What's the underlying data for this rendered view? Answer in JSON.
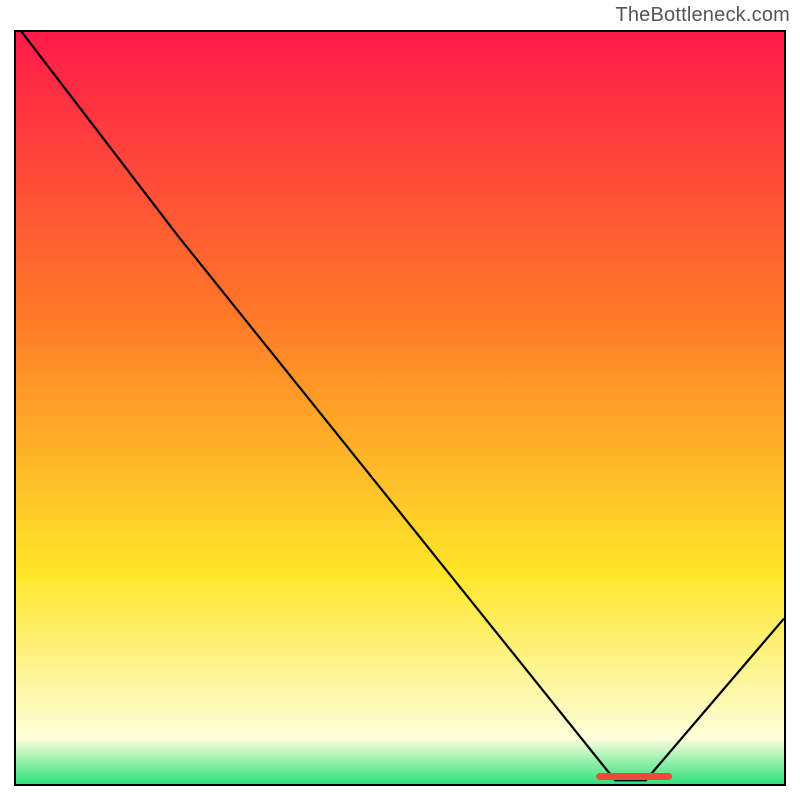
{
  "watermark": "TheBottleneck.com",
  "colors": {
    "gradient_top": "#ff1a4a",
    "gradient_mid_upper": "#ff7a28",
    "gradient_mid_lower": "#ffe629",
    "gradient_pale": "#feffdc",
    "gradient_bottom": "#2fe07a",
    "line": "#000000",
    "marker": "#ef4b3a",
    "border": "#000000"
  },
  "chart_data": {
    "type": "line",
    "title": "",
    "xlabel": "",
    "ylabel": "",
    "xlim": [
      0,
      100
    ],
    "ylim": [
      0,
      100
    ],
    "x": [
      0,
      21,
      78,
      82,
      100
    ],
    "values": [
      101,
      73,
      0.5,
      0.5,
      22
    ],
    "annotations": [
      {
        "name": "baseline-marker",
        "x": [
          76,
          85
        ],
        "y": 1.0
      }
    ]
  }
}
